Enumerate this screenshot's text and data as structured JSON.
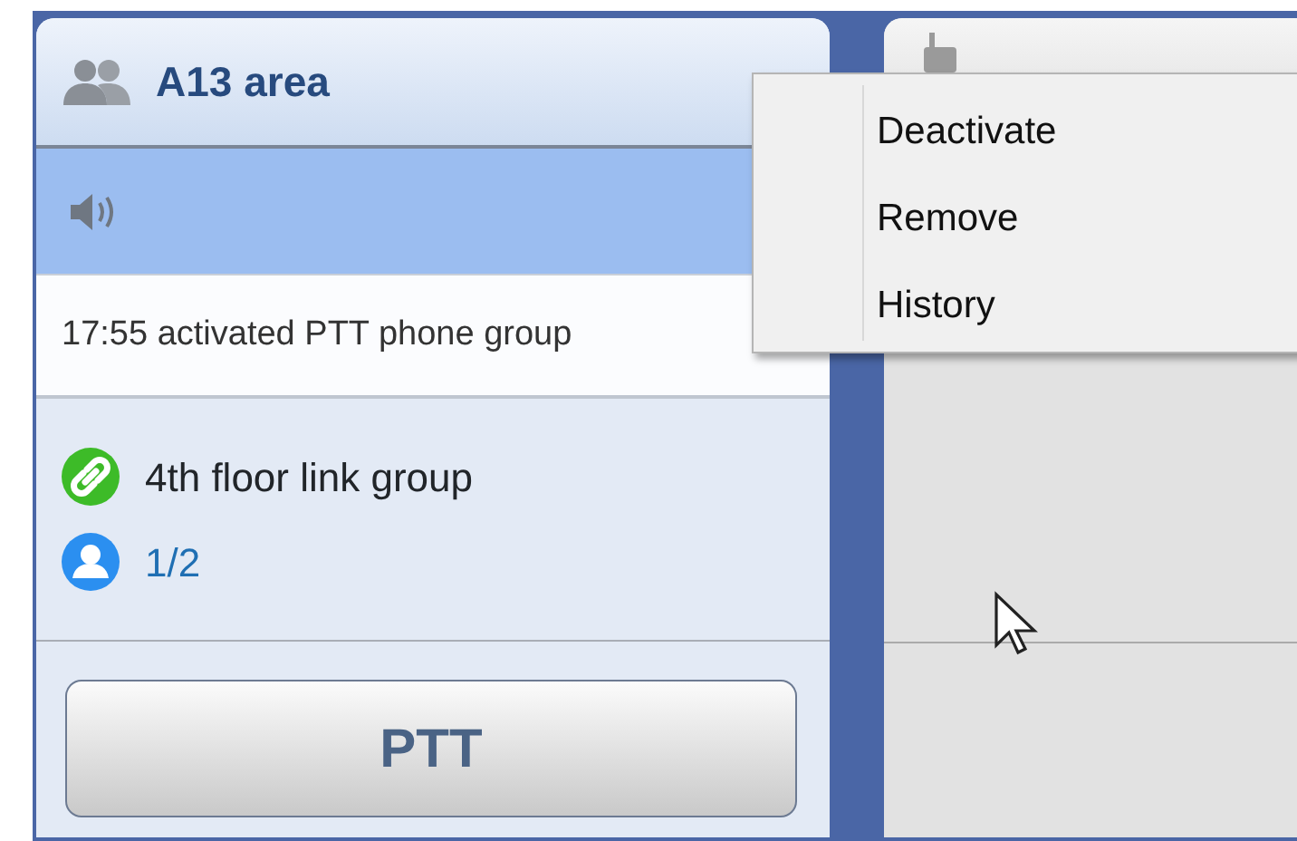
{
  "group_panel": {
    "title": "A13 area",
    "audio_row": {
      "selected": true
    },
    "event": "17:55 activated PTT phone group",
    "link_group": "4th floor link group",
    "members": "1/2",
    "ptt_button": "PTT"
  },
  "context_menu": {
    "items": [
      {
        "label": "Deactivate"
      },
      {
        "label": "Remove"
      },
      {
        "label": "History"
      }
    ]
  }
}
